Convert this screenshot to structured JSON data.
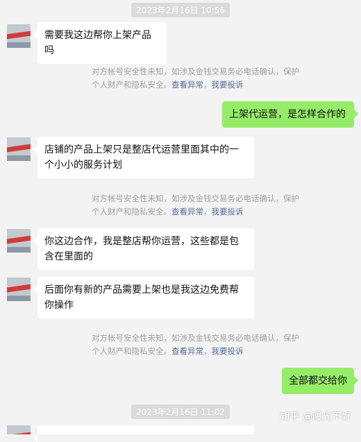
{
  "timestamps": [
    "2023年2月16日  10:56",
    "2023年2月16日  11:02"
  ],
  "messages": [
    {
      "side": "in",
      "text": "需要我这边帮你上架产品吗"
    },
    {
      "side": "out",
      "text": "上架代运营，是怎样合作的"
    },
    {
      "side": "in",
      "text": "店铺的产品上架只是整店代运营里面其中的一个小小的服务计划"
    },
    {
      "side": "in",
      "text": "你这边合作，我是整店帮你运营，这些都是包含在里面的"
    },
    {
      "side": "in",
      "text": "后面你有新的产品需要上架也是我这边免费帮你操作"
    },
    {
      "side": "out",
      "text": "全部都交给你"
    }
  ],
  "notice": {
    "text": "对方帐号安全性未知，如涉及金钱交易务必电话确认，保护个人财产和隐私安全。",
    "link_anomaly": "查看异常",
    "separator": "，",
    "link_complaint": "我要投诉"
  },
  "watermark": "知乎 @曝光不好",
  "colors": {
    "bubble_out": "#95ec69",
    "bubble_in": "#ffffff",
    "link": "#576b95",
    "background": "#f3f3f3"
  }
}
